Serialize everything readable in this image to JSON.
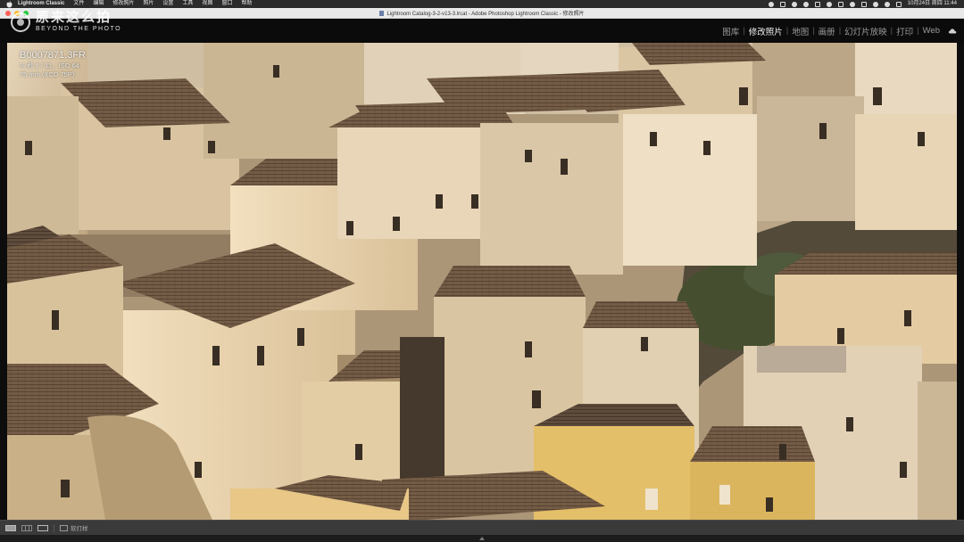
{
  "menubar": {
    "app": "Lightroom Classic",
    "items": [
      "文件",
      "编辑",
      "修改照片",
      "照片",
      "设置",
      "工具",
      "视图",
      "窗口",
      "帮助"
    ],
    "datetime": "10月24日 周四 11:44"
  },
  "window": {
    "title": "Lightroom Catalog-3-2-v13-3.lrcat - Adobe Photoshop Lightroom Classic - 修改照片"
  },
  "watermark": {
    "cn": "原来这么拍",
    "en": "BEYOND THE PHOTO"
  },
  "modules": [
    {
      "label": "图库",
      "active": false
    },
    {
      "label": "修改照片",
      "active": true
    },
    {
      "label": "地图",
      "active": false
    },
    {
      "label": "画册",
      "active": false
    },
    {
      "label": "幻灯片放映",
      "active": false
    },
    {
      "label": "打印",
      "active": false
    },
    {
      "label": "Web",
      "active": false
    }
  ],
  "photo_info": {
    "filename": "B0007871.3FR",
    "exposure": "⅛ 秒 ƒ / 11，ISO 64",
    "lens": "75 mm (XCD 75P)"
  },
  "toolbar": {
    "before_after_label": "软打样"
  },
  "colors": {
    "accent_active": "#f0f0f0",
    "module_inactive": "#9a9a9a",
    "stone": "#d9c7a8",
    "roof": "#6b5542",
    "yellow_facade": "#e3c06a"
  }
}
